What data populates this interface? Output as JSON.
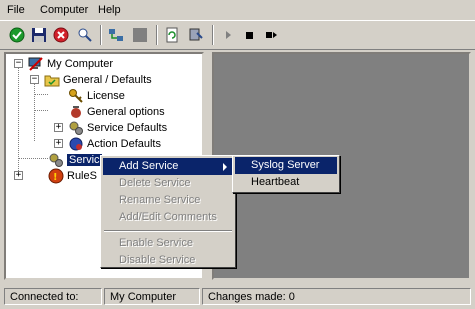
{
  "menubar": {
    "items": [
      "File",
      "Computer",
      "Help"
    ]
  },
  "toolbar": {
    "buttons": [
      "apply-icon",
      "save-icon",
      "cancel-icon",
      "settings-icon",
      "network-icon",
      "stop-square-icon",
      "refresh-icon",
      "install-icon",
      "play-icon",
      "stop-icon",
      "step-icon"
    ]
  },
  "tree": {
    "root": "My Computer",
    "general": "General / Defaults",
    "license": "License",
    "general_options": "General options",
    "service_defaults": "Service Defaults",
    "action_defaults": "Action Defaults",
    "services": "Servic",
    "rulesets": "RuleS"
  },
  "context_menu": {
    "items": [
      {
        "label": "Add Service",
        "enabled": true,
        "highlighted": true,
        "has_submenu": true
      },
      {
        "label": "Delete Service",
        "enabled": false
      },
      {
        "label": "Rename Service",
        "enabled": false
      },
      {
        "label": "Add/Edit Comments",
        "enabled": false
      },
      {
        "label": "Enable Service",
        "enabled": false
      },
      {
        "label": "Disable Service",
        "enabled": false
      }
    ]
  },
  "submenu": {
    "items": [
      {
        "label": "Syslog Server",
        "highlighted": true
      },
      {
        "label": "Heartbeat",
        "highlighted": false
      }
    ]
  },
  "statusbar": {
    "connected_label": "Connected to:",
    "computer": "My Computer",
    "changes": "Changes made: 0"
  },
  "colors": {
    "highlight": "#0a246a",
    "face": "#d4d0c8",
    "workspace": "#808080"
  }
}
